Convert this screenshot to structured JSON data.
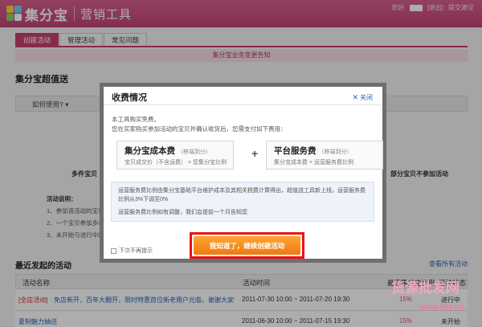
{
  "header": {
    "brand": "集分宝",
    "subtitle": "营销工具",
    "greeting": "您好",
    "logout": "[退出]",
    "contact": "提交建议"
  },
  "tabs": [
    {
      "label": "创建活动",
      "active": true
    },
    {
      "label": "管理活动",
      "active": false
    },
    {
      "label": "常见问题",
      "active": false
    }
  ],
  "notice": "集分宝业务变更告知",
  "page": {
    "section_title": "集分宝超值送",
    "how_to_use": "如何使用? ▾",
    "left_text": "多件宝贝",
    "right_text": "部分宝贝不参加活动",
    "rules_title": "活动说明：",
    "rules": [
      "1、参加该活动的宝贝可以同",
      "2、一个宝贝参加多999",
      "3、未开始与进行中的宝贝"
    ]
  },
  "recent": {
    "title": "最近发起的活动",
    "view_all": "查看所有活动",
    "columns": [
      "活动名称",
      "活动时间",
      "最高集分宝比例",
      "活动状态"
    ],
    "rows": [
      {
        "name_tag": "[全店活动]",
        "name": "免店新开，百年大翻开，限时特惠首位新老用户光临，谢谢大家!",
        "time": "2011-07-30 10:00 ~ 2011-07-20 19:30",
        "pct": "15%",
        "status": "进行中"
      },
      {
        "name_tag": "",
        "name": "夏制魅力抽送",
        "time": "2011-06-30 10:00 ~ 2011-07-15 19:30",
        "pct": "15%",
        "status": "未开始"
      }
    ]
  },
  "modal": {
    "title": "收费情况",
    "close": "关闭",
    "intro_1": "本工具购买免费。",
    "intro_2": "您在买家购买参加活动的宝贝并确认收货后，您需支付如下费用：",
    "fee_left": {
      "title": "集分宝成本费",
      "note": "（移端到分）",
      "formula": "宝贝成交价（不含运费） × 您集分宝比例"
    },
    "plus": "+",
    "fee_right": {
      "title": "平台服务费",
      "note": "（移端到分）",
      "formula": "集分宝成本费 × 运营服务费比例"
    },
    "info_1": "运营服务费比例由集分宝基础平台维护成本及其相关税费计算得出，超值送工具新上线，运营服务费",
    "info_2": "比例从3%下调至0%",
    "info_3": "运营服务费比例如有调整，我们会提前一个月告知您",
    "confirm": "我知道了，继续创建活动",
    "dont_show": "下次不再提示"
  },
  "watermark": {
    "big": "货源批发网",
    "url": "www.6pf.cn"
  }
}
